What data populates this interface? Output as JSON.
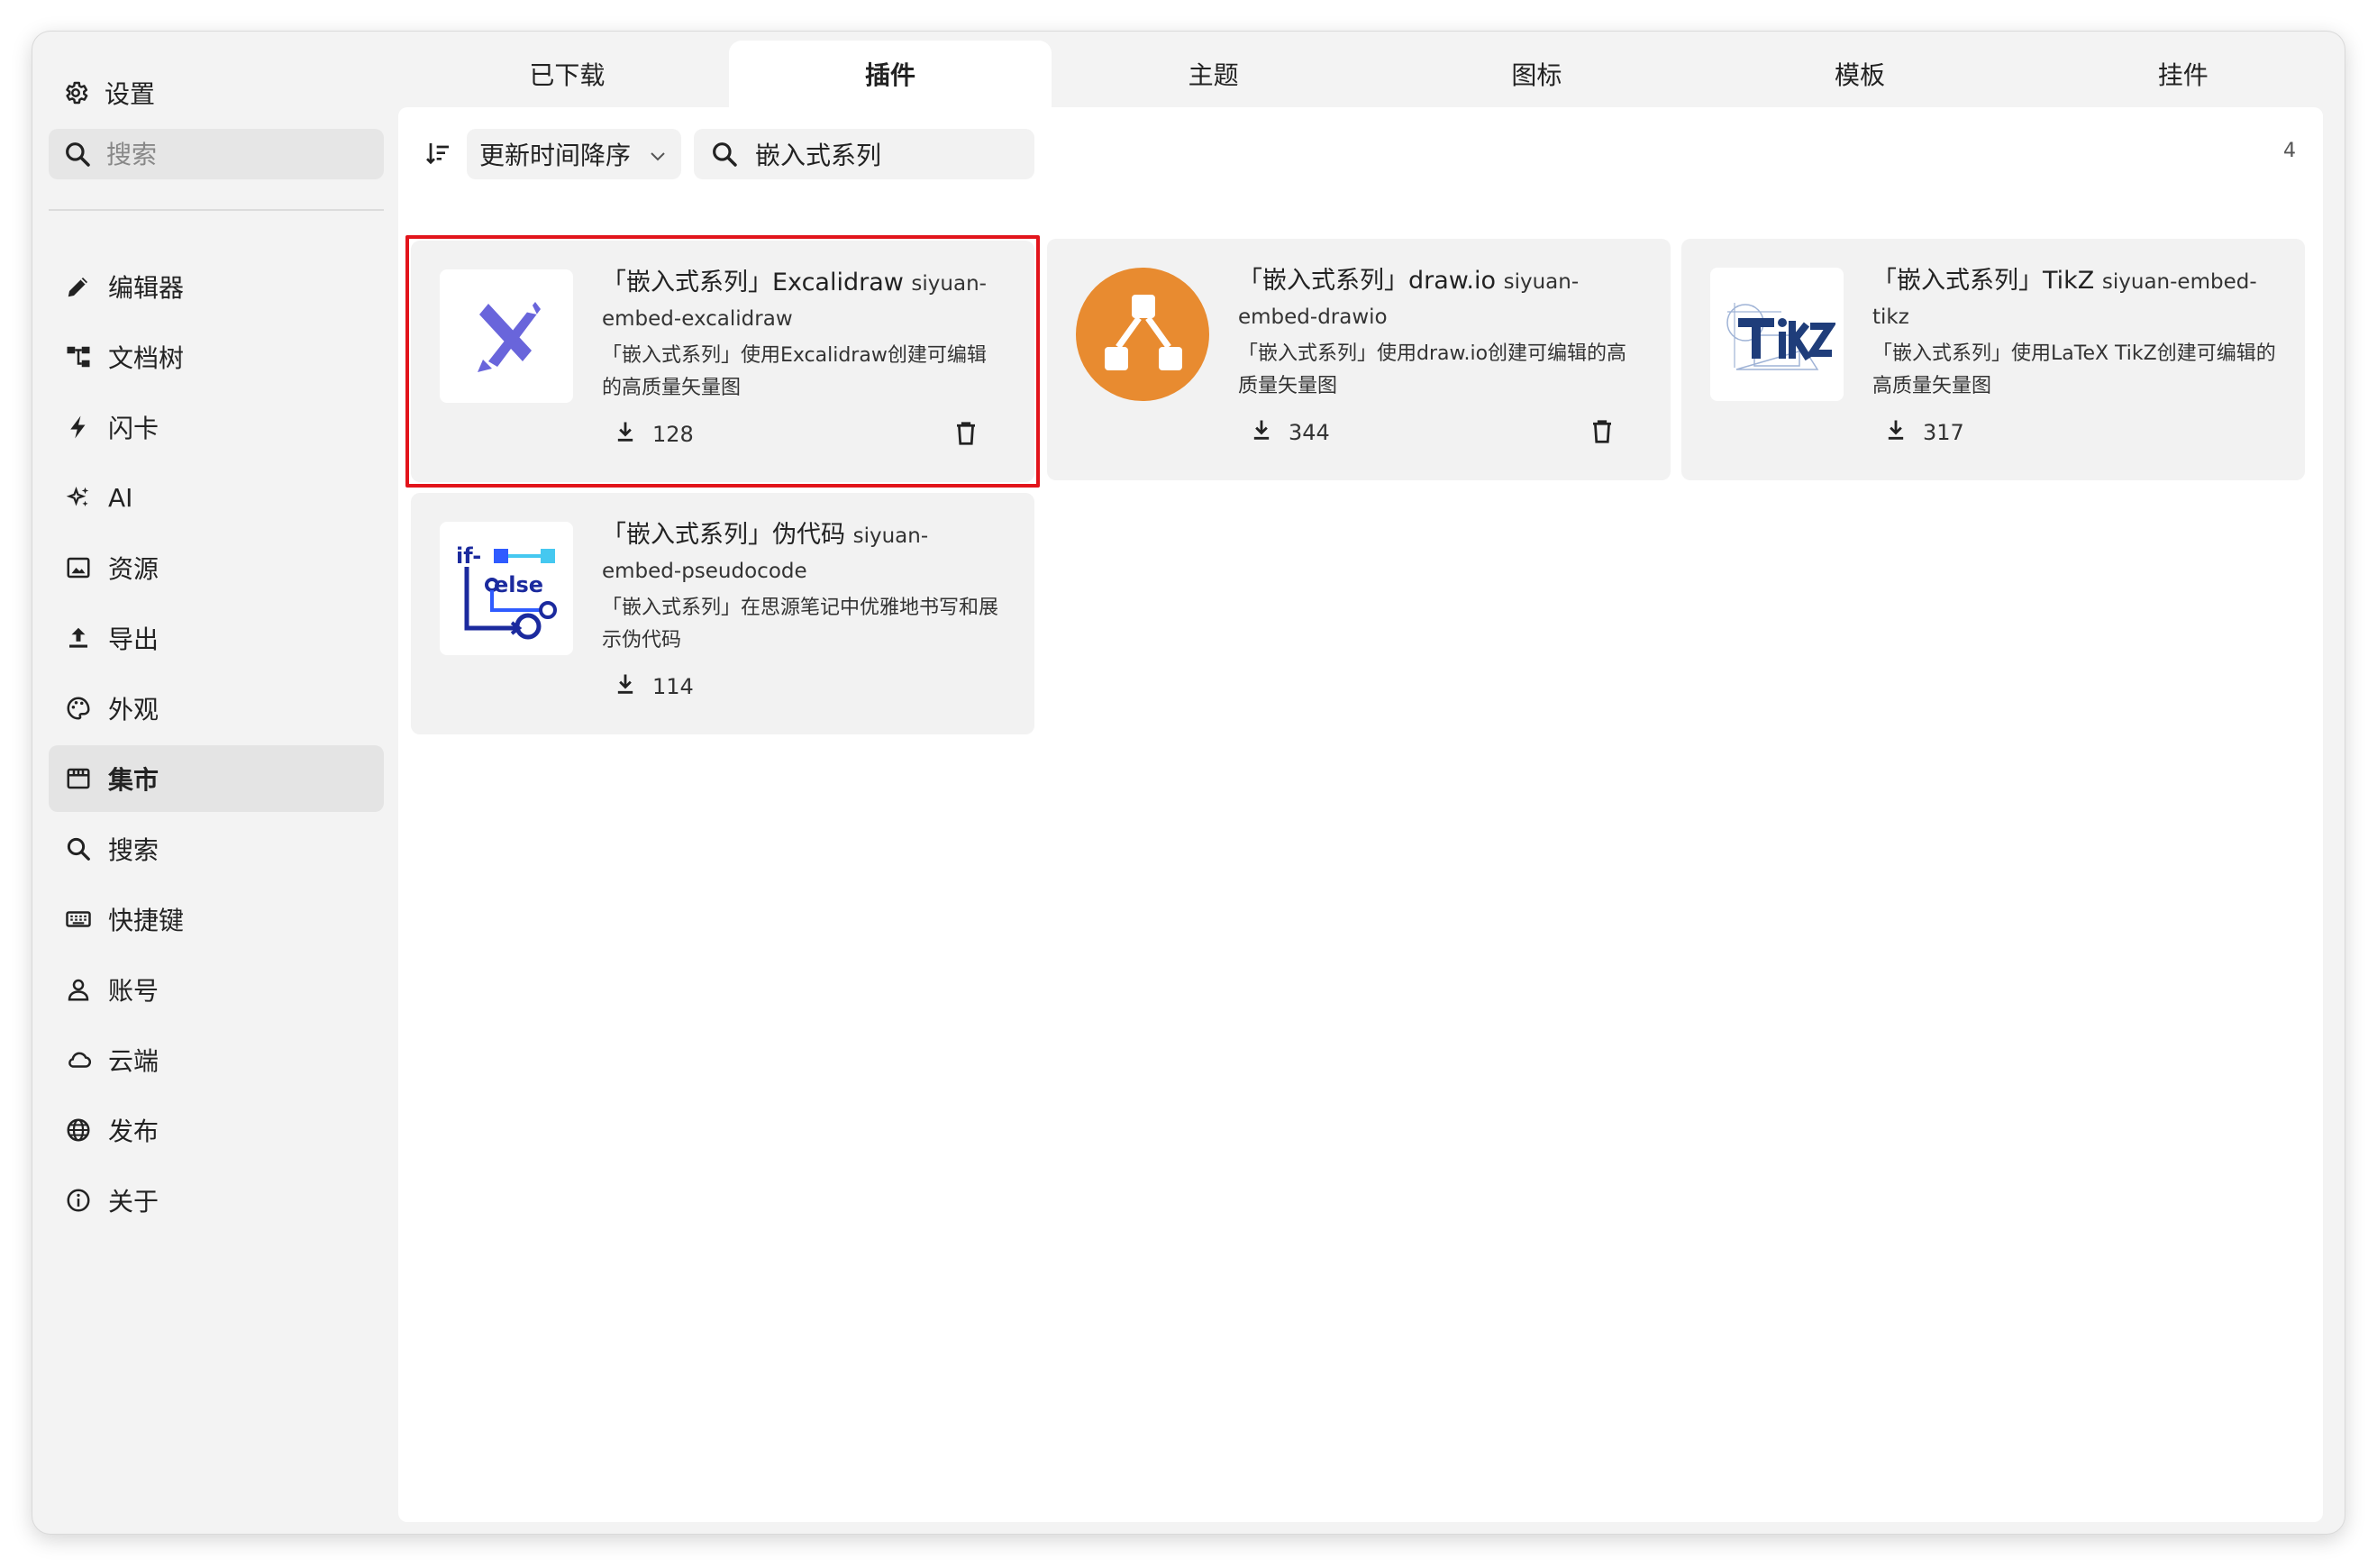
{
  "sidebar": {
    "title": "设置",
    "search_placeholder": "搜索",
    "items": [
      {
        "label": "编辑器",
        "icon": "pencil-icon"
      },
      {
        "label": "文档树",
        "icon": "tree-icon"
      },
      {
        "label": "闪卡",
        "icon": "flash-icon"
      },
      {
        "label": "AI",
        "icon": "sparkle-icon"
      },
      {
        "label": "资源",
        "icon": "image-icon"
      },
      {
        "label": "导出",
        "icon": "export-icon"
      },
      {
        "label": "外观",
        "icon": "palette-icon"
      },
      {
        "label": "集市",
        "icon": "store-icon",
        "active": true
      },
      {
        "label": "搜索",
        "icon": "search-icon"
      },
      {
        "label": "快捷键",
        "icon": "keyboard-icon"
      },
      {
        "label": "账号",
        "icon": "user-icon"
      },
      {
        "label": "云端",
        "icon": "cloud-icon"
      },
      {
        "label": "发布",
        "icon": "globe-icon"
      },
      {
        "label": "关于",
        "icon": "info-icon"
      }
    ]
  },
  "tabs": [
    {
      "label": "已下载"
    },
    {
      "label": "插件",
      "active": true
    },
    {
      "label": "主题"
    },
    {
      "label": "图标"
    },
    {
      "label": "模板"
    },
    {
      "label": "挂件"
    }
  ],
  "toolbar": {
    "sort_label": "更新时间降序",
    "search_value": "嵌入式系列",
    "count": "4"
  },
  "plugins": [
    {
      "name": "「嵌入式系列」Excalidraw",
      "package": "siyuan-embed-excalidraw",
      "description": "「嵌入式系列」使用Excalidraw创建可编辑的高质量矢量图",
      "downloads": "128",
      "icon": "excalidraw-icon",
      "installed": true,
      "selected": true
    },
    {
      "name": "「嵌入式系列」draw.io",
      "package": "siyuan-embed-drawio",
      "description": "「嵌入式系列」使用draw.io创建可编辑的高质量矢量图",
      "downloads": "344",
      "icon": "drawio-icon",
      "installed": true
    },
    {
      "name": "「嵌入式系列」TikZ",
      "package": "siyuan-embed-tikz",
      "description": "「嵌入式系列」使用LaTeX TikZ创建可编辑的高质量矢量图",
      "downloads": "317",
      "icon": "tikz-icon",
      "installed": false
    },
    {
      "name": "「嵌入式系列」伪代码",
      "package": "siyuan-embed-pseudocode",
      "description": "「嵌入式系列」在思源笔记中优雅地书写和展示伪代码",
      "downloads": "114",
      "icon": "pseudocode-icon",
      "installed": false
    }
  ],
  "colors": {
    "accent_highlight": "#e2141b",
    "excalidraw": "#6965db",
    "drawio": "#e88b30",
    "tikz": "#1f3d7a",
    "pseudocode": "#1b2a9e"
  }
}
